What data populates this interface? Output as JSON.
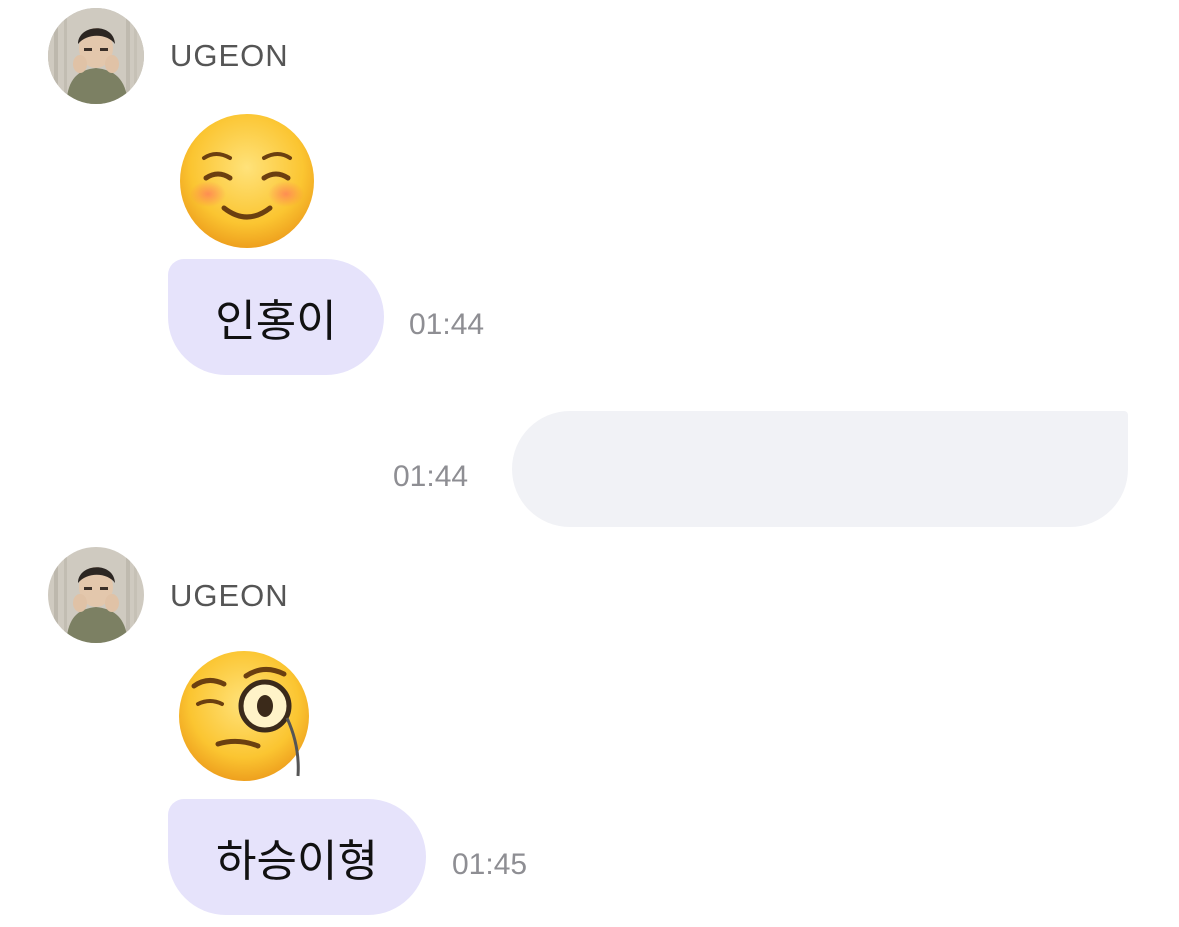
{
  "messages": [
    {
      "sender": "UGEON",
      "avatar_icon": "profile-photo",
      "emoji_icon": "smiling-face-with-closed-eyes-emoji",
      "text": "인홍이",
      "time": "01:44"
    },
    {
      "sender": "",
      "text": "",
      "time": "01:44"
    },
    {
      "sender": "UGEON",
      "avatar_icon": "profile-photo",
      "emoji_icon": "face-with-monocle-emoji",
      "text": "하승이형",
      "time": "01:45"
    }
  ],
  "colors": {
    "incoming_bubble": "#e6e3fb",
    "outgoing_bubble": "#f1f2f6",
    "timestamp": "#8e8e93",
    "sender_name": "#555555"
  }
}
